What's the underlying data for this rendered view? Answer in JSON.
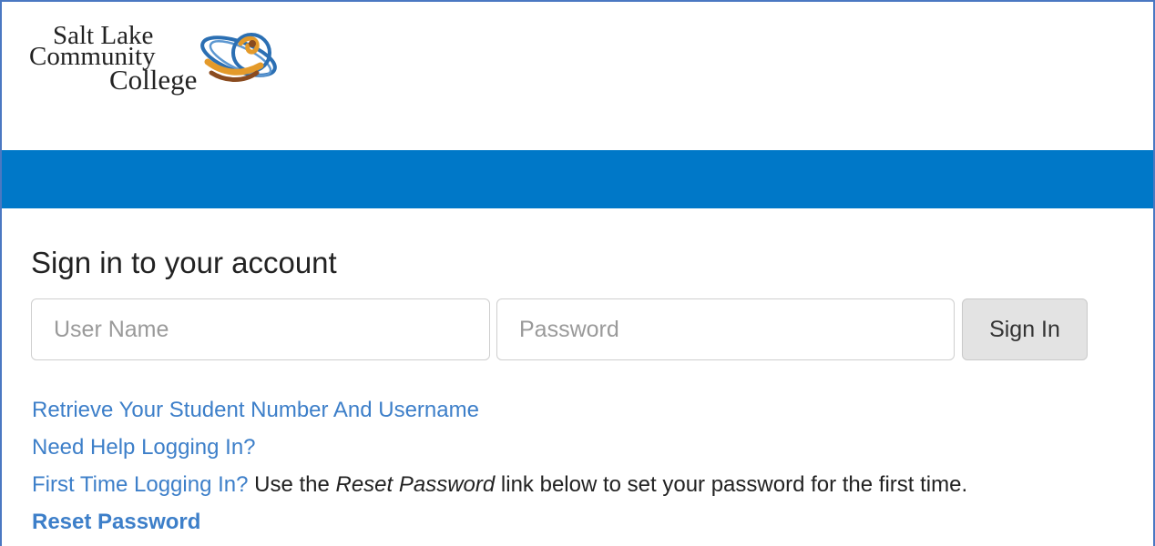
{
  "header": {
    "logo": {
      "line1": "Salt Lake",
      "line2": "Community",
      "line3": "College",
      "icon": "slcc-swirl-logo-icon",
      "colors": [
        "#2b6fb3",
        "#e49a2a",
        "#8a4b1f"
      ]
    }
  },
  "colors": {
    "accent_bar": "#0078c8",
    "link": "#3d7fc9",
    "button_bg": "#e3e3e3"
  },
  "login": {
    "title": "Sign in to your account",
    "username_placeholder": "User Name",
    "username_value": "",
    "password_placeholder": "Password",
    "password_value": "",
    "signin_label": "Sign In"
  },
  "links": {
    "retrieve": "Retrieve Your Student Number And Username",
    "help": "Need Help Logging In?",
    "first_time": "First Time Logging In?",
    "first_time_text_before": " Use the ",
    "first_time_emph": "Reset Password",
    "first_time_text_after": " link below to set your password for the first time.",
    "reset": "Reset Password"
  }
}
